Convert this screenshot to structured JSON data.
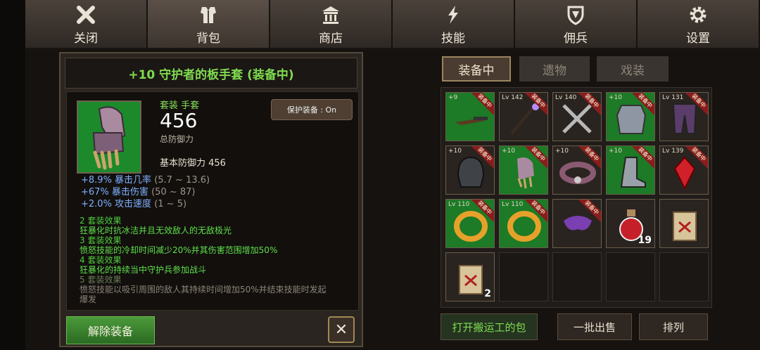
{
  "nav": [
    {
      "label": "关闭",
      "icon": "close-icon"
    },
    {
      "label": "背包",
      "icon": "armor-icon"
    },
    {
      "label": "商店",
      "icon": "shop-icon"
    },
    {
      "label": "技能",
      "icon": "skill-icon"
    },
    {
      "label": "佣兵",
      "icon": "shield-icon"
    },
    {
      "label": "设置",
      "icon": "gear-icon"
    }
  ],
  "detail": {
    "title": "+10 守护者的板手套 (装备中)",
    "set_label": "套装 手套",
    "value": "456",
    "total_def_label": "总防御力",
    "base_def": "基本防御力 456",
    "protect": "保护装备 : On",
    "stats": [
      {
        "text": "+8.9% 暴击几率",
        "range": "(5.7 ~ 13.6)"
      },
      {
        "text": "+67% 暴击伤害",
        "range": "(50 ~ 87)"
      },
      {
        "text": "+2.0% 攻击速度",
        "range": "(1 ~ 5)"
      }
    ],
    "effects": [
      {
        "head": "2 套装效果",
        "desc": "狂暴化时抗冰洁并且无效敌人的无敌极光",
        "active": true
      },
      {
        "head": "3 套装效果",
        "desc": "愤怒技能的冷却时间减少20%并其伤害范围增加50%",
        "active": true
      },
      {
        "head": "4 套装效果",
        "desc": "狂暴化的持续当中守护兵参加战斗",
        "active": true
      },
      {
        "head": "5 套装效果",
        "desc": "愤怒技能以吸引周围的敌人其持续时间增加50%并结束技能时发起",
        "desc2": "爆发",
        "active": false
      }
    ],
    "unequip": "解除装备",
    "close": "✕"
  },
  "tabs": [
    "装备中",
    "遗物",
    "戏装"
  ],
  "slots": [
    {
      "lv": "+9",
      "eq": "装备中",
      "green": true,
      "art": "gun"
    },
    {
      "lv": "Lv 142",
      "eq": "装备中",
      "green": false,
      "art": "staff"
    },
    {
      "lv": "Lv 140",
      "eq": "装备中",
      "green": false,
      "art": "swords"
    },
    {
      "lv": "+10",
      "eq": "装备中",
      "green": true,
      "art": "chest"
    },
    {
      "lv": "Lv 131",
      "eq": "装备中",
      "green": false,
      "art": "legs"
    },
    {
      "lv": "+10",
      "eq": "装备中",
      "green": false,
      "art": "helm"
    },
    {
      "lv": "+10",
      "eq": "装备中",
      "green": true,
      "art": "glove"
    },
    {
      "lv": "+10",
      "eq": "装备中",
      "green": false,
      "art": "belt"
    },
    {
      "lv": "+10",
      "eq": "装备中",
      "green": true,
      "art": "boot"
    },
    {
      "lv": "Lv 139",
      "eq": "装备中",
      "green": false,
      "art": "gem"
    },
    {
      "lv": "Lv 110",
      "eq": "装备中",
      "green": true,
      "art": "ring"
    },
    {
      "lv": "Lv 110",
      "eq": "装备中",
      "green": true,
      "art": "ring"
    },
    {
      "lv": "",
      "eq": "装备中",
      "green": false,
      "art": "mask"
    },
    {
      "lv": "",
      "eq": "",
      "green": false,
      "art": "potion",
      "count": "19"
    },
    {
      "lv": "",
      "eq": "",
      "green": false,
      "art": "scroll"
    },
    {
      "lv": "",
      "eq": "",
      "green": false,
      "art": "scroll",
      "count": "2"
    },
    {
      "empty": true
    },
    {
      "empty": true
    },
    {
      "empty": true
    },
    {
      "empty": true
    }
  ],
  "buttons": {
    "open_porter": "打开搬运工的包",
    "bulk_sell": "一批出售",
    "sort": "排列"
  },
  "colors": {
    "accent_green": "#7fdb4f",
    "slot_green": "#1d7a26",
    "equipped_badge": "#8a1c1c"
  }
}
